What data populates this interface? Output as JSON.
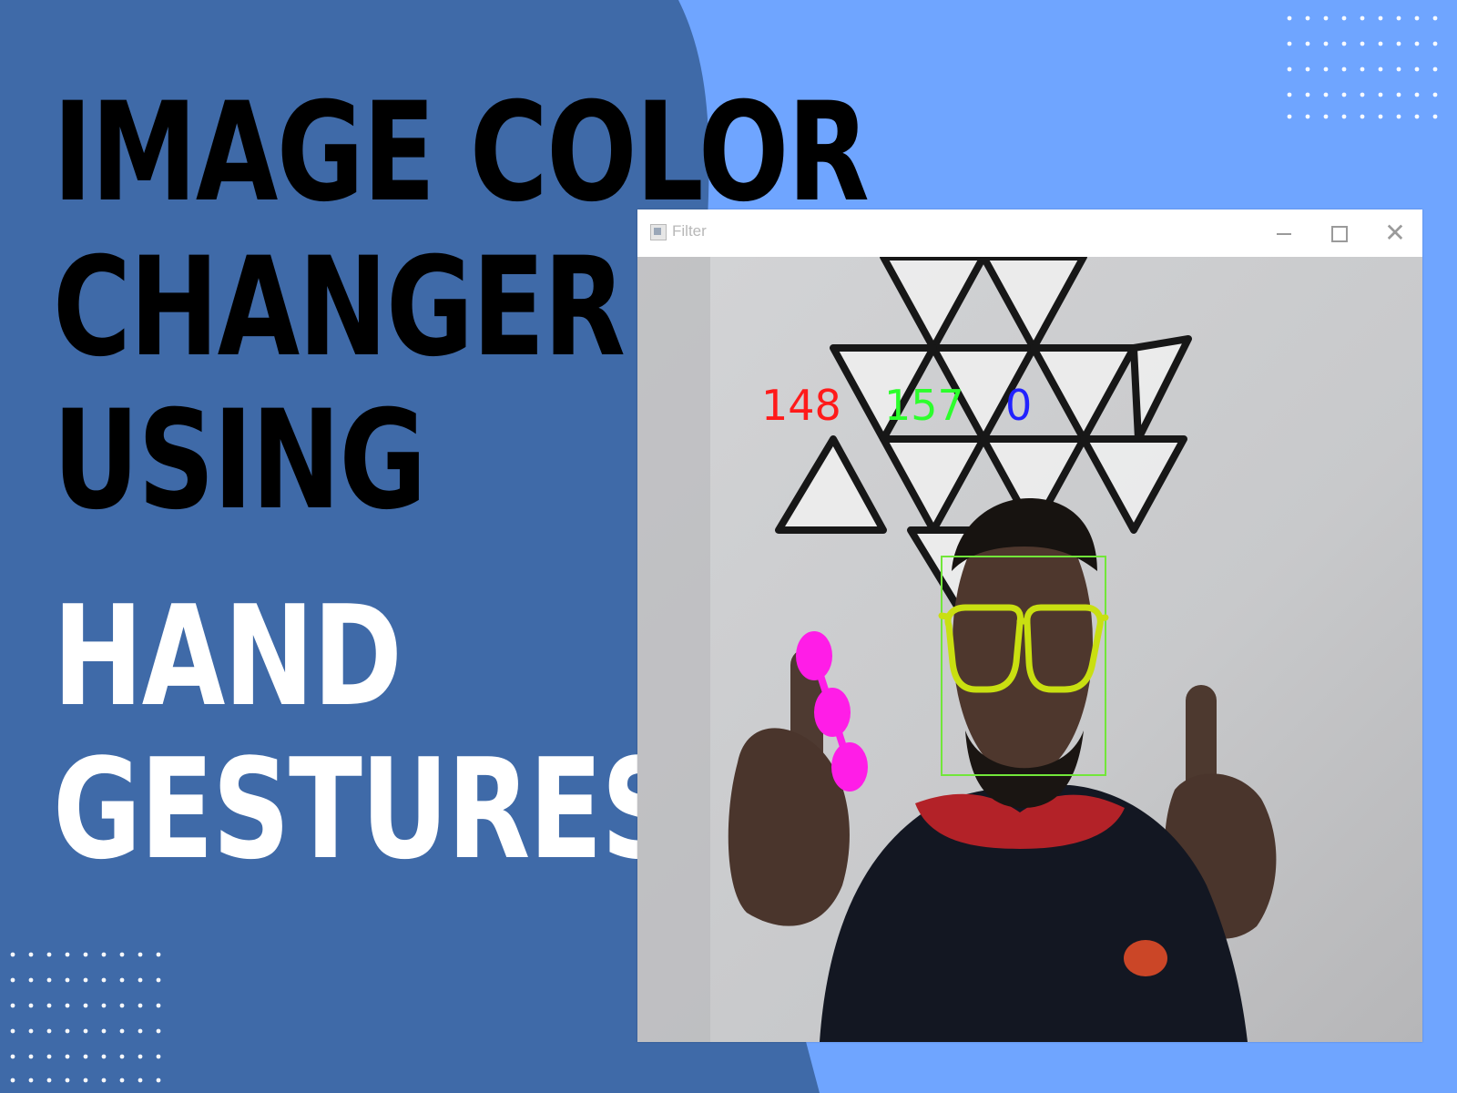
{
  "headline": {
    "line1": "IMAGE COLOR",
    "line2": "CHANGER",
    "line3": "USING",
    "line4": "HAND",
    "line5": "GESTURES"
  },
  "window": {
    "title": "Filter",
    "minimize_icon": "minimize-icon",
    "maximize_icon": "maximize-icon",
    "close_icon": "close-icon",
    "close_glyph": "✕"
  },
  "overlay": {
    "red_value": "148",
    "green_value": "157",
    "blue_value": "0"
  },
  "colors": {
    "left_panel": "#3f6aa8",
    "right_bg": "#6fa5ff",
    "headline_dark": "#000000",
    "headline_light": "#ffffff",
    "red_text": "#ff1a1a",
    "green_text": "#2cff2c",
    "blue_text": "#2222ff",
    "face_box": "#72e63a",
    "glasses": "#c9df11",
    "finger_markers": "#ff1de7"
  }
}
